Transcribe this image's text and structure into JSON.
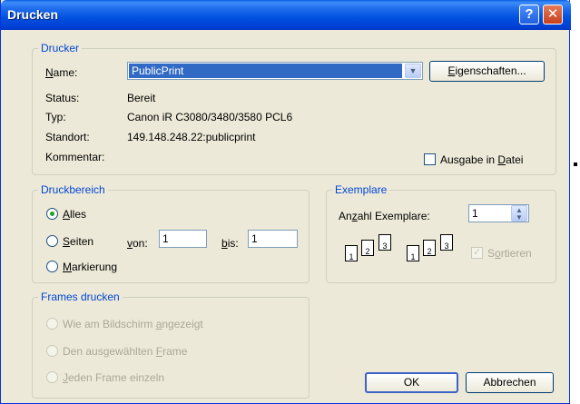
{
  "window": {
    "title": "Drucken"
  },
  "titlebar": {
    "help_glyph": "?",
    "close_glyph": "✕"
  },
  "printer": {
    "group_label": "Drucker",
    "name_label": "Name:",
    "name_value": "PublicPrint",
    "properties_button": "Eigenschaften...",
    "status_label": "Status:",
    "status_value": "Bereit",
    "type_label": "Typ:",
    "type_value": "Canon iR C3080/3480/3580 PCL6",
    "location_label": "Standort:",
    "location_value": "149.148.248.22:publicprint",
    "comment_label": "Kommentar:",
    "print_to_file_label": "Ausgabe in Datei",
    "print_to_file_checked": false
  },
  "range": {
    "group_label": "Druckbereich",
    "all_label": "Alles",
    "pages_label": "Seiten",
    "from_label": "von:",
    "from_value": "1",
    "to_label": "bis:",
    "to_value": "1",
    "selection_label": "Markierung",
    "selected": "all"
  },
  "copies": {
    "group_label": "Exemplare",
    "count_label": "Anzahl Exemplare:",
    "count_value": "1",
    "collate_label": "Sortieren",
    "collate_enabled": false,
    "page_numbers": [
      "1",
      "2",
      "3"
    ]
  },
  "frames": {
    "group_label": "Frames drucken",
    "options": [
      "Wie am Bildschirm angezeigt",
      "Den ausgewählten Frame",
      "Jeden Frame einzeln"
    ],
    "enabled": false
  },
  "footer": {
    "ok": "OK",
    "cancel": "Abbrechen"
  },
  "colors": {
    "title_blue": "#0050e0",
    "group_label": "#0046d5",
    "dialog_bg": "#ece9d8",
    "selection": "#316ac5"
  },
  "icons": {
    "help": "help-icon",
    "close": "close-icon",
    "dropdown": "chevron-down-icon",
    "spinner": "spinner-icon"
  }
}
